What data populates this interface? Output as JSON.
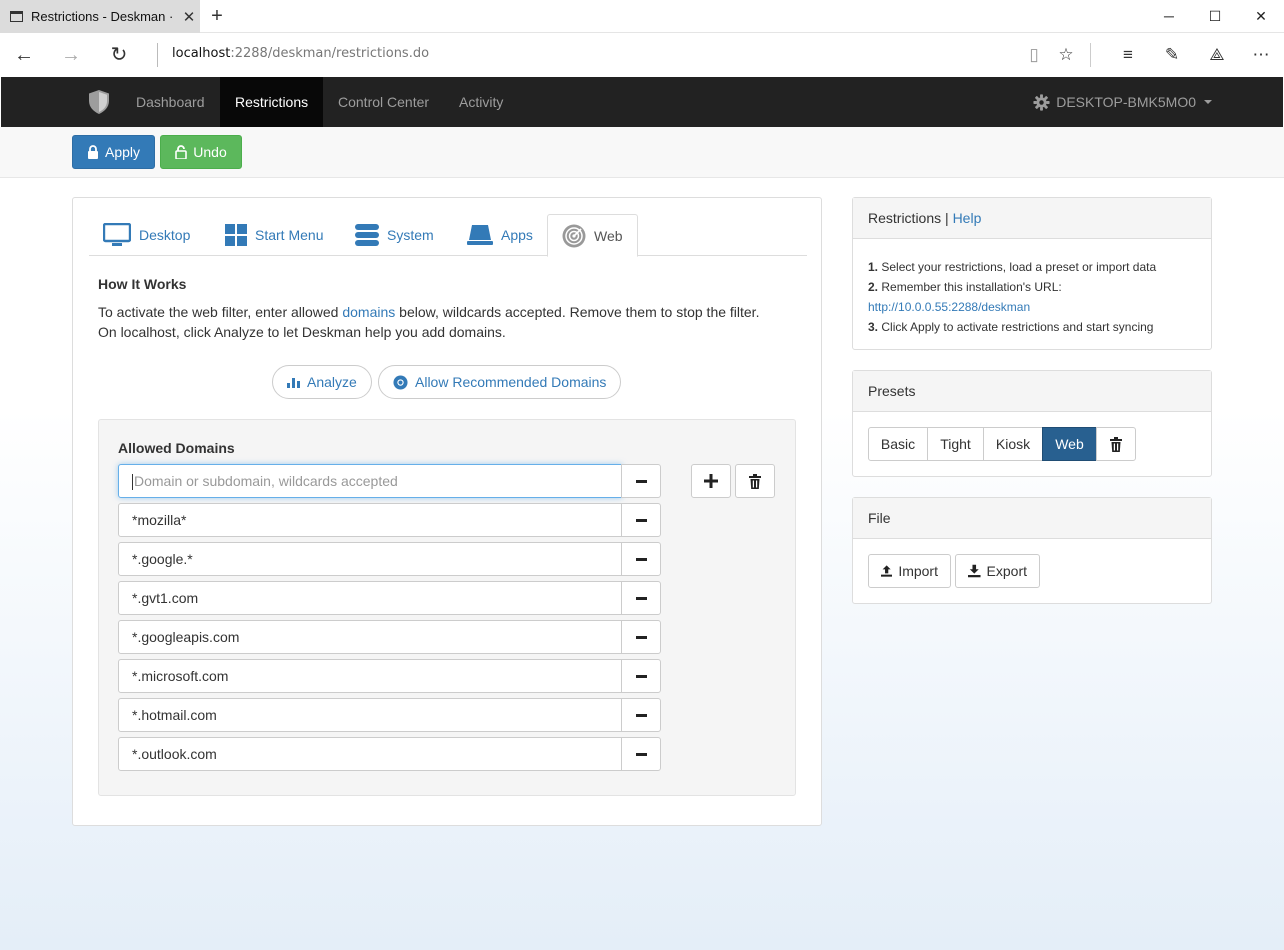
{
  "browser": {
    "tab_title": "Restrictions - Deskman ·",
    "url_host": "localhost",
    "url_rest": ":2288/deskman/restrictions.do"
  },
  "navbar": {
    "items": [
      {
        "label": "Dashboard"
      },
      {
        "label": "Restrictions"
      },
      {
        "label": "Control Center"
      },
      {
        "label": "Activity"
      }
    ],
    "active": "Restrictions",
    "host": "DESKTOP-BMK5MO0"
  },
  "toolbar": {
    "apply_label": "Apply",
    "undo_label": "Undo"
  },
  "tabs": [
    {
      "label": "Desktop",
      "icon": "monitor-icon"
    },
    {
      "label": "Start Menu",
      "icon": "windows-icon"
    },
    {
      "label": "System",
      "icon": "database-icon"
    },
    {
      "label": "Apps",
      "icon": "laptop-icon"
    },
    {
      "label": "Web",
      "icon": "web-radar-icon"
    }
  ],
  "active_tab": "Web",
  "how": {
    "title": "How It Works",
    "line1_pre": "To activate the web filter, enter allowed ",
    "line1_link": "domains",
    "line1_post": " below, wildcards accepted. Remove them to stop the filter.",
    "line2": "On localhost, click Analyze to let Deskman help you add domains."
  },
  "actions": {
    "analyze_label": "Analyze",
    "recommended_label": "Allow Recommended Domains"
  },
  "domains": {
    "title": "Allowed Domains",
    "placeholder": "Domain or subdomain, wildcards accepted",
    "entries": [
      "*mozilla*",
      "*.google.*",
      "*.gvt1.com",
      "*.googleapis.com",
      "*.microsoft.com",
      "*.hotmail.com",
      "*.outlook.com"
    ]
  },
  "restrictions_panel": {
    "title": "Restrictions",
    "separator": "|",
    "help": "Help",
    "step1_num": "1.",
    "step1": "Select your restrictions, load a preset or import data",
    "step2_num": "2.",
    "step2": "Remember this installation's URL:",
    "url": "http://10.0.0.55:2288/deskman",
    "step3_num": "3.",
    "step3": "Click Apply to activate restrictions and start syncing"
  },
  "presets_panel": {
    "title": "Presets",
    "options": [
      "Basic",
      "Tight",
      "Kiosk",
      "Web"
    ],
    "active": "Web"
  },
  "file_panel": {
    "title": "File",
    "import_label": "Import",
    "export_label": "Export"
  },
  "colors": {
    "primary": "#337ab7",
    "success": "#5cb85c",
    "navbar": "#222222",
    "active_preset": "#286090"
  }
}
